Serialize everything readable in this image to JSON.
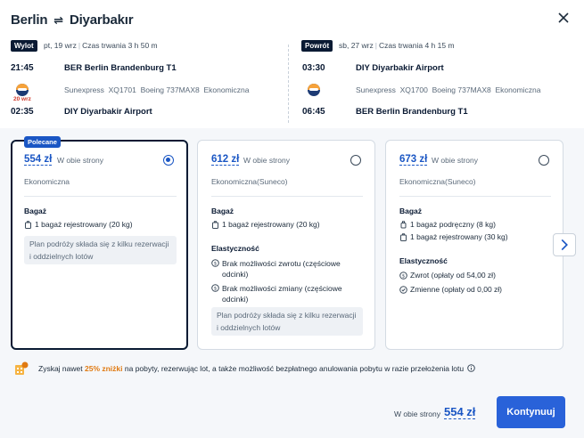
{
  "header": {
    "from": "Berlin",
    "to": "Diyarbakır"
  },
  "outbound": {
    "tag": "Wylot",
    "date": "pt, 19 wrz",
    "duration": "Czas trwania 3 h 50 m",
    "dep_time": "21:45",
    "dep_airport": "BER Berlin Brandenburg T1",
    "carrier": "Sunexpress",
    "flight": "XQ1701",
    "aircraft": "Boeing 737MAX8",
    "cabin": "Ekonomiczna",
    "next_day": "20 wrz",
    "arr_time": "02:35",
    "arr_airport": "DIY Diyarbakir Airport"
  },
  "return": {
    "tag": "Powrót",
    "date": "sb, 27 wrz",
    "duration": "Czas trwania 4 h 15 m",
    "dep_time": "03:30",
    "dep_airport": "DIY Diyarbakir Airport",
    "carrier": "Sunexpress",
    "flight": "XQ1700",
    "aircraft": "Boeing 737MAX8",
    "cabin": "Ekonomiczna",
    "arr_time": "06:45",
    "arr_airport": "BER Berlin Brandenburg T1"
  },
  "fares": [
    {
      "badge": "Polecane",
      "price": "554 zł",
      "per": "W obie strony",
      "cabin": "Ekonomiczna",
      "baggage_title": "Bagaż",
      "baggage": [
        "1 bagaż rejestrowany (20 kg)"
      ],
      "note": "Plan podróży składa się z kilku rezerwacji i oddzielnych lotów"
    },
    {
      "price": "612 zł",
      "per": "W obie strony",
      "cabin": "Ekonomiczna(Suneco)",
      "baggage_title": "Bagaż",
      "baggage": [
        "1 bagaż rejestrowany (20 kg)"
      ],
      "flex_title": "Elastyczność",
      "flex": [
        "Brak możliwości zwrotu (częściowe odcinki)",
        "Brak możliwości zmiany (częściowe odcinki)"
      ],
      "note": "Plan podróży składa się z kilku rezerwacji i oddzielnych lotów"
    },
    {
      "price": "673 zł",
      "per": "W obie strony",
      "cabin": "Ekonomiczna(Suneco)",
      "baggage_title": "Bagaż",
      "baggage": [
        "1 bagaż podręczny (8 kg)",
        "1 bagaż rejestrowany (30 kg)"
      ],
      "flex_title": "Elastyczność",
      "flex": [
        "Zwrot (opłaty od 54,00 zł)",
        "Zmienne (opłaty od 0,00 zł)"
      ]
    }
  ],
  "promo": {
    "pre": "Zyskaj nawet",
    "highlight": "25% zniżki",
    "post": "na pobyty, rezerwując lot, a także możliwość bezpłatnego anulowania pobytu w razie przełożenia lotu"
  },
  "footer": {
    "per": "W obie strony",
    "total": "554 zł",
    "button": "Kontynuuj"
  },
  "colors": {
    "accent": "#2962d9",
    "dark": "#0a1a33",
    "promo": "#e07a12"
  }
}
